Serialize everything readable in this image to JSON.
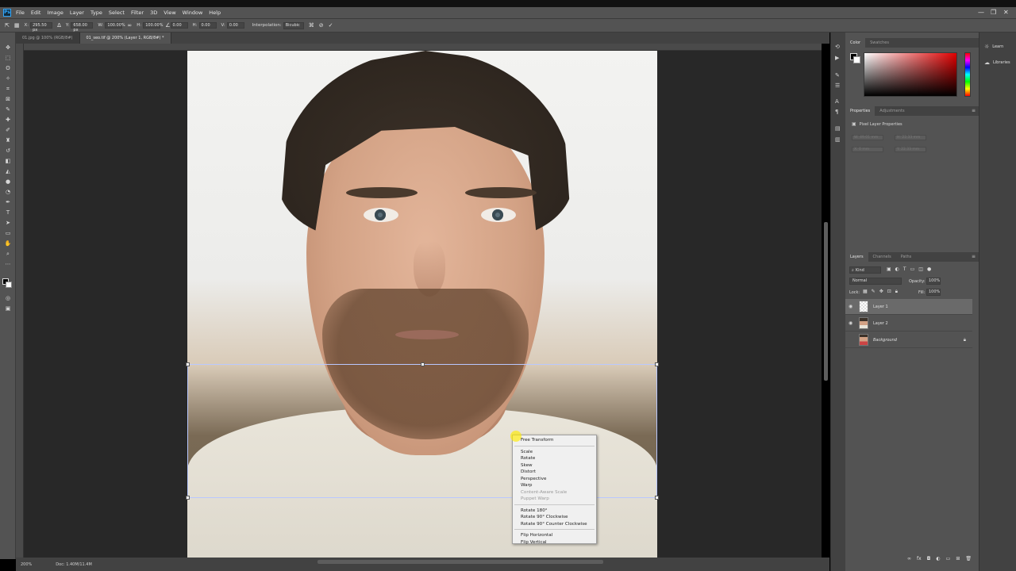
{
  "menubar": {
    "logo": "Ps",
    "items": [
      "File",
      "Edit",
      "Image",
      "Layer",
      "Type",
      "Select",
      "Filter",
      "3D",
      "View",
      "Window",
      "Help"
    ],
    "window_controls": [
      "—",
      "❐",
      "✕"
    ]
  },
  "options": {
    "x_label": "X:",
    "x_value": "295.50 px",
    "y_label": "Y:",
    "y_value": "658.00 px",
    "w_label": "W:",
    "w_value": "100.00%",
    "h_label": "H:",
    "h_value": "100.00%",
    "angle_value": "0.00",
    "hskew_label": "H:",
    "hskew_value": "0.00",
    "vskew_label": "V:",
    "vskew_value": "0.00",
    "interpolation_label": "Interpolation:",
    "interpolation_value": "Bicubic"
  },
  "tabs": [
    {
      "label": "01.jpg @ 100% (RGB/8#)",
      "active": false
    },
    {
      "label": "01_seo.tif @ 200% (Layer 1, RGB/8#) *",
      "active": true
    }
  ],
  "context_menu": {
    "group1": [
      "Free Transform"
    ],
    "group2": [
      {
        "label": "Scale",
        "disabled": false
      },
      {
        "label": "Rotate",
        "disabled": false
      },
      {
        "label": "Skew",
        "disabled": false
      },
      {
        "label": "Distort",
        "disabled": false
      },
      {
        "label": "Perspective",
        "disabled": false
      },
      {
        "label": "Warp",
        "disabled": false
      },
      {
        "label": "Content-Aware Scale",
        "disabled": true
      },
      {
        "label": "Puppet Warp",
        "disabled": true
      }
    ],
    "group3": [
      "Rotate 180°",
      "Rotate 90° Clockwise",
      "Rotate 90° Counter Clockwise"
    ],
    "group4": [
      "Flip Horizontal",
      "Flip Vertical"
    ]
  },
  "status": {
    "zoom": "200%",
    "doc": "Doc: 1.40M/11.4M"
  },
  "panels": {
    "color_tabs": [
      "Color",
      "Swatches"
    ],
    "properties_tabs": [
      "Properties",
      "Adjustments"
    ],
    "properties_title": "Pixel Layer Properties",
    "properties_fields": [
      "W: 49.01 mm",
      "H: 22.33 mm",
      "X: 0 mm",
      "Y: 22.33 mm"
    ],
    "layers_tabs": [
      "Layers",
      "Channels",
      "Paths"
    ],
    "kind_label": "Kind",
    "blend_mode": "Normal",
    "opacity_label": "Opacity:",
    "opacity_value": "100%",
    "lock_label": "Lock:",
    "fill_label": "Fill:",
    "fill_value": "100%",
    "layers": [
      {
        "name": "Layer 1",
        "selected": true,
        "visible": true,
        "locked": false
      },
      {
        "name": "Layer 2",
        "selected": false,
        "visible": true,
        "locked": false
      },
      {
        "name": "Background",
        "selected": false,
        "visible": false,
        "locked": true
      }
    ]
  },
  "far_right": {
    "learn": "Learn",
    "libraries": "Libraries"
  },
  "colors": {
    "accent": "#31a8ff",
    "panel_bg": "#535353",
    "canvas_bg": "#282828",
    "menu_bg": "#f0f0f0"
  }
}
